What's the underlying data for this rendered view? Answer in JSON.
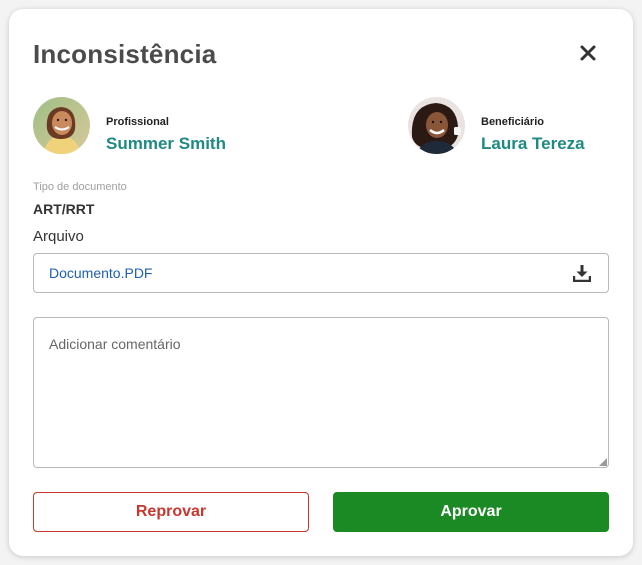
{
  "modal": {
    "title": "Inconsistência",
    "close_icon": "close-icon"
  },
  "professional": {
    "role": "Profissional",
    "name": "Summer Smith",
    "avatar_icon": "person-photo"
  },
  "beneficiary": {
    "role": "Beneficiário",
    "name": "Laura Tereza",
    "avatar_icon": "person-photo"
  },
  "document": {
    "type_label": "Tipo de documento",
    "type_value": "ART/RRT",
    "file_label": "Arquivo",
    "file_name": "Documento.PDF",
    "download_icon": "download-icon"
  },
  "comment": {
    "placeholder": "Adicionar comentário",
    "value": ""
  },
  "actions": {
    "reject_label": "Reprovar",
    "approve_label": "Aprovar"
  },
  "colors": {
    "name_teal": "#1f8a84",
    "link_blue": "#1f5fb3",
    "reject_red": "#c7372f",
    "approve_green": "#1b8a24"
  }
}
